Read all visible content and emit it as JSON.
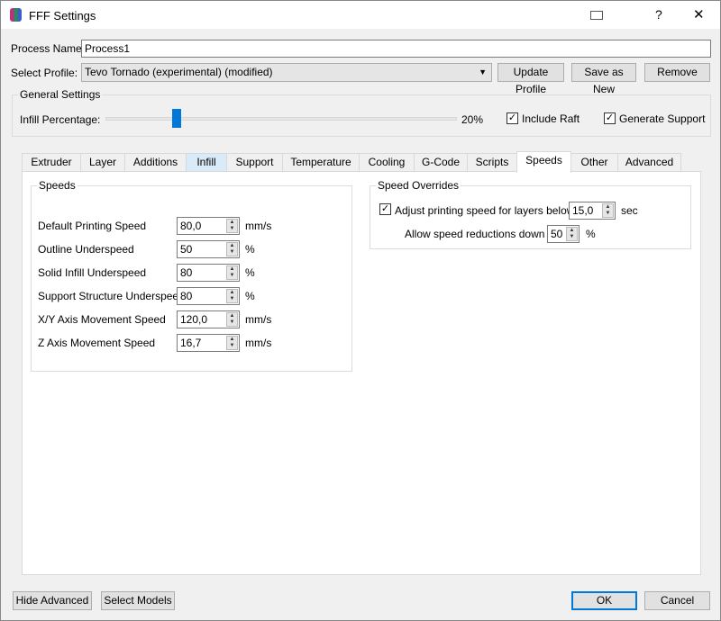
{
  "window": {
    "title": "FFF Settings",
    "help": "?",
    "close": "✕"
  },
  "process": {
    "label": "Process Name:",
    "value": "Process1"
  },
  "profile": {
    "label": "Select Profile:",
    "value": "Tevo Tornado (experimental) (modified)",
    "update": "Update Profile",
    "save_new": "Save as New",
    "remove": "Remove"
  },
  "general": {
    "title": "General Settings",
    "infill_label": "Infill Percentage:",
    "infill_value": "20%",
    "infill_fraction": 0.2,
    "raft": "Include Raft",
    "raft_checked": true,
    "support": "Generate Support",
    "support_checked": true
  },
  "tabs": [
    "Extruder",
    "Layer",
    "Additions",
    "Infill",
    "Support",
    "Temperature",
    "Cooling",
    "G-Code",
    "Scripts",
    "Speeds",
    "Other",
    "Advanced"
  ],
  "active_tab": "Speeds",
  "speeds": {
    "title": "Speeds",
    "rows": [
      {
        "label": "Default Printing Speed",
        "value": "80,0",
        "unit": "mm/s"
      },
      {
        "label": "Outline Underspeed",
        "value": "50",
        "unit": "%"
      },
      {
        "label": "Solid Infill Underspeed",
        "value": "80",
        "unit": "%"
      },
      {
        "label": "Support Structure Underspeed",
        "value": "80",
        "unit": "%"
      },
      {
        "label": "X/Y Axis Movement Speed",
        "value": "120,0",
        "unit": "mm/s"
      },
      {
        "label": "Z Axis Movement Speed",
        "value": "16,7",
        "unit": "mm/s"
      }
    ]
  },
  "overrides": {
    "title": "Speed Overrides",
    "adjust_label": "Adjust printing speed for layers below",
    "adjust_value": "15,0",
    "adjust_unit": "sec",
    "allow_label": "Allow speed reductions down to",
    "allow_value": "50",
    "allow_unit": "%"
  },
  "footer": {
    "hide_advanced": "Hide Advanced",
    "select_models": "Select Models",
    "ok": "OK",
    "cancel": "Cancel"
  }
}
